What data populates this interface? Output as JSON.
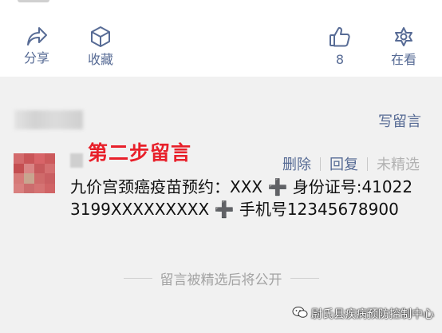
{
  "actions": {
    "share": {
      "label": "分享",
      "icon": "share-icon"
    },
    "favorite": {
      "label": "收藏",
      "icon": "cube-icon"
    },
    "like": {
      "count": "8",
      "icon": "thumbs-up-icon"
    },
    "looking": {
      "label": "在看",
      "icon": "flower-icon"
    }
  },
  "comments": {
    "write_label": "写留言",
    "annotation": "第二步留言",
    "ops": {
      "delete": "删除",
      "reply": "回复",
      "featured": "未精选"
    },
    "text": "九价宫颈癌疫苗预约：XXX ➕ 身份证号:410223199XXXXXXXXX ➕ 手机号12345678900",
    "notice": "留言被精选后将公开"
  },
  "watermark": {
    "text": "尉氏县疾病预防控制中心"
  },
  "colors": {
    "link": "#576b95",
    "annotation": "#e8202a",
    "muted": "#b2b2b2",
    "background": "#f1f1f1"
  }
}
